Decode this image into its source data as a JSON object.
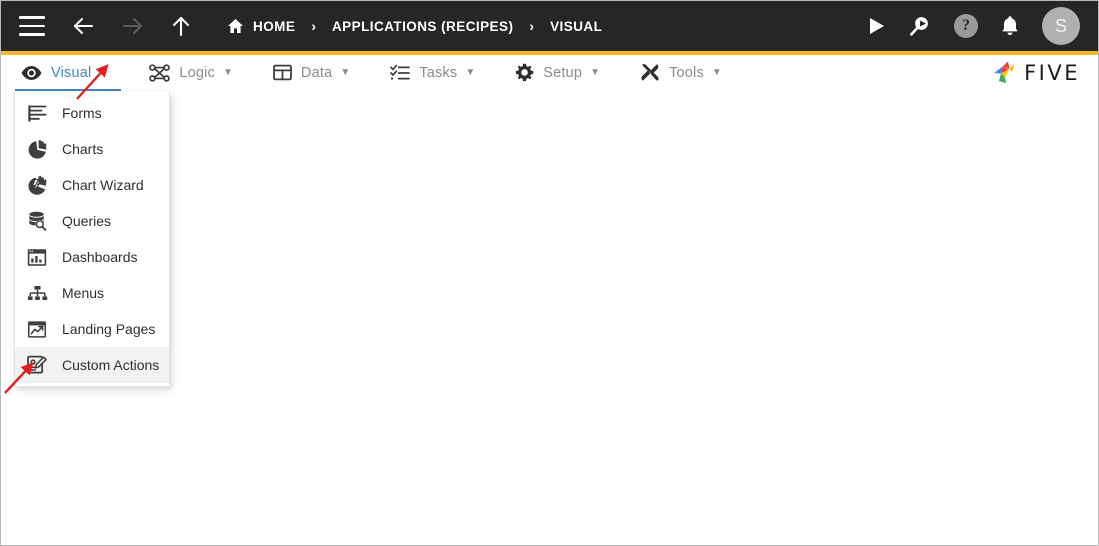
{
  "header": {
    "menu_icon": "hamburger-icon",
    "back_icon": "arrow-left-icon",
    "forward_icon": "arrow-right-icon",
    "up_icon": "arrow-up-icon",
    "breadcrumbs": [
      {
        "label": "HOME",
        "icon": "home-icon"
      },
      {
        "label": "APPLICATIONS (RECIPES)",
        "icon": ""
      },
      {
        "label": "VISUAL",
        "icon": ""
      }
    ],
    "separator": "›",
    "actions": [
      {
        "name": "run-button",
        "icon": "play-icon",
        "label": ""
      },
      {
        "name": "search-button",
        "icon": "search-icon",
        "label": ""
      },
      {
        "name": "help-button",
        "icon": "help-icon",
        "label": "?"
      },
      {
        "name": "notifications-button",
        "icon": "bell-icon",
        "label": ""
      }
    ],
    "avatar_initial": "S"
  },
  "menubar": {
    "items": [
      {
        "label": "Visual",
        "icon": "eye-icon",
        "caret": "▼",
        "active": true
      },
      {
        "label": "Logic",
        "icon": "logic-nodes-icon",
        "caret": "▼",
        "active": false
      },
      {
        "label": "Data",
        "icon": "table-grid-icon",
        "caret": "▼",
        "active": false
      },
      {
        "label": "Tasks",
        "icon": "checklist-icon",
        "caret": "▼",
        "active": false
      },
      {
        "label": "Setup",
        "icon": "gear-icon",
        "caret": "▼",
        "active": false
      },
      {
        "label": "Tools",
        "icon": "wrench-screwdriver-icon",
        "caret": "▼",
        "active": false
      }
    ],
    "brand": "FIVE"
  },
  "dropdown": {
    "owner": "Visual",
    "items": [
      {
        "label": "Forms",
        "icon": "form-lines-icon",
        "hover": false
      },
      {
        "label": "Charts",
        "icon": "pie-chart-icon",
        "hover": false
      },
      {
        "label": "Chart Wizard",
        "icon": "chart-wizard-icon",
        "hover": false
      },
      {
        "label": "Queries",
        "icon": "database-search-icon",
        "hover": false
      },
      {
        "label": "Dashboards",
        "icon": "dashboard-icon",
        "hover": false
      },
      {
        "label": "Menus",
        "icon": "hierarchy-icon",
        "hover": false
      },
      {
        "label": "Landing Pages",
        "icon": "landing-page-icon",
        "hover": false
      },
      {
        "label": "Custom Actions",
        "icon": "custom-action-icon",
        "hover": true
      }
    ]
  },
  "colors": {
    "topbar_bg": "#262626",
    "accent": "#f5b829",
    "active_tab": "#4285c8",
    "inactive_tab": "#8b8b8b",
    "hover_bg": "#f2f2f2",
    "annotation": "#e02020"
  },
  "annotations": [
    {
      "name": "arrow-to-visual-caret",
      "color": "#e02020"
    },
    {
      "name": "arrow-to-custom-actions",
      "color": "#e02020"
    }
  ]
}
